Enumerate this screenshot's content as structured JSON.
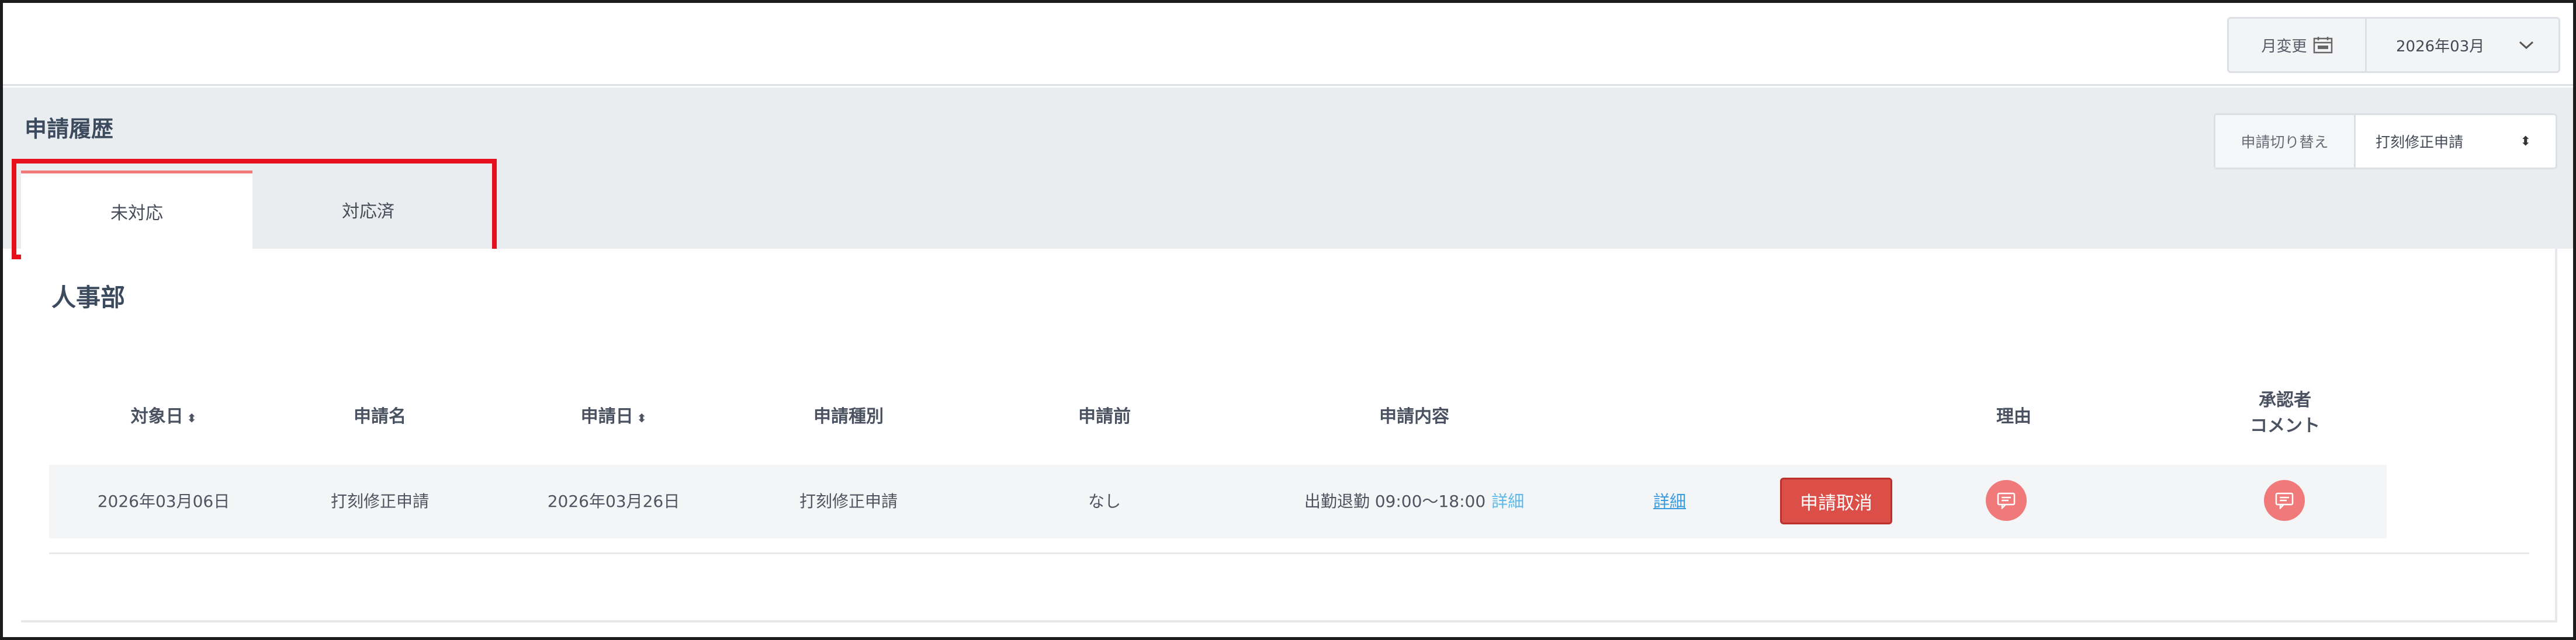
{
  "topbar": {
    "month_change_label": "月変更",
    "month_value": "2026年03月"
  },
  "header": {
    "title": "申請履歴",
    "switch_label": "申請切り替え",
    "switch_value": "打刻修正申請"
  },
  "tabs": [
    {
      "label": "未対応",
      "active": true
    },
    {
      "label": "対応済",
      "active": false
    }
  ],
  "department": "人事部",
  "table": {
    "columns": {
      "target_date": "対象日",
      "request_name": "申請名",
      "request_date": "申請日",
      "request_type": "申請種別",
      "before": "申請前",
      "content": "申請内容",
      "reason": "理由",
      "approver_comment_line1": "承認者",
      "approver_comment_line2": "コメント"
    },
    "rows": [
      {
        "target_date": "2026年03月06日",
        "request_name": "打刻修正申請",
        "request_date": "2026年03月26日",
        "request_type": "打刻修正申請",
        "before": "なし",
        "content": "出勤退勤 09:00～18:00",
        "content_link": "詳細",
        "detail_link": "詳細",
        "cancel_label": "申請取消"
      }
    ]
  },
  "colors": {
    "accent": "#f07a7a",
    "cancel": "#dc4f49",
    "link": "#3a9be0",
    "highlight": "#e5101b"
  },
  "icons": {
    "calendar": "calendar-icon",
    "chevron": "chevron-down-icon",
    "sort": "sort-icon",
    "comment": "comment-icon"
  }
}
